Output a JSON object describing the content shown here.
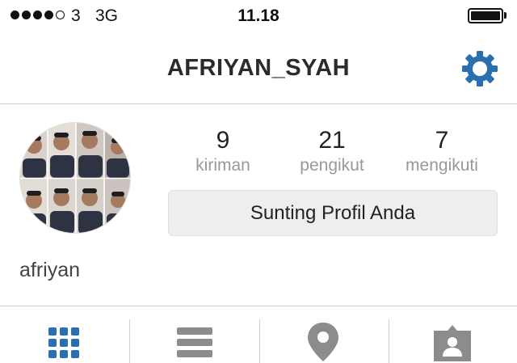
{
  "status_bar": {
    "signal_bars": 5,
    "signal_filled": 4,
    "carrier": "3",
    "network": "3G",
    "time": "11.18",
    "battery_level": 1.0
  },
  "header": {
    "title": "AFRIYAN_SYAH",
    "settings_icon": "gear-icon",
    "accent_color": "#2a6fb0"
  },
  "profile": {
    "stats": [
      {
        "value": "9",
        "label": "kiriman"
      },
      {
        "value": "21",
        "label": "pengikut"
      },
      {
        "value": "7",
        "label": "mengikuti"
      }
    ],
    "edit_button_label": "Sunting Profil Anda",
    "username": "afriyan"
  },
  "tab_bar": {
    "tabs": [
      {
        "icon": "grid-icon",
        "active": true,
        "color": "#2a6fb0"
      },
      {
        "icon": "list-icon",
        "active": false,
        "color": "#8c8c8c"
      },
      {
        "icon": "location-pin-icon",
        "active": false,
        "color": "#8c8c8c"
      },
      {
        "icon": "tagged-person-icon",
        "active": false,
        "color": "#8c8c8c"
      }
    ]
  }
}
